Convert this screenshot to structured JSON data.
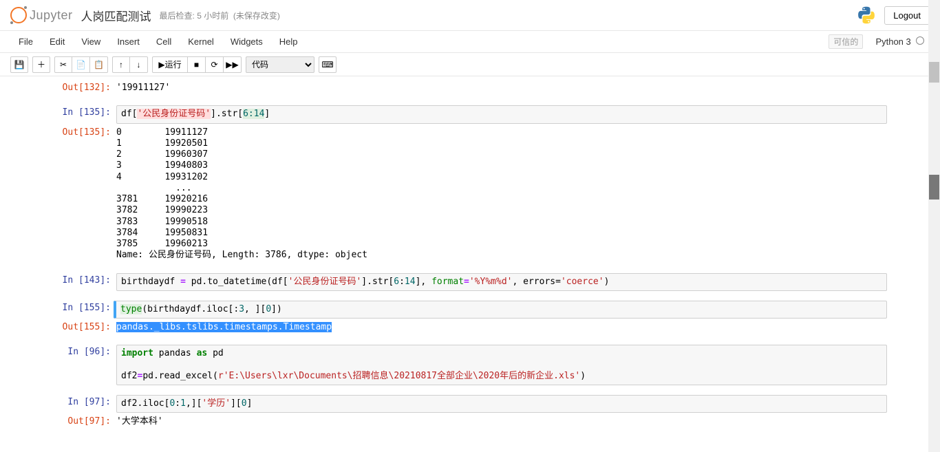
{
  "header": {
    "logo_text": "Jupyter",
    "notebook_name": "人岗匹配测试",
    "last_check": "最后检查: 5 小时前",
    "unsaved": "(未保存改变)",
    "logout": "Logout"
  },
  "menu": {
    "file": "File",
    "edit": "Edit",
    "view": "View",
    "insert": "Insert",
    "cell": "Cell",
    "kernel": "Kernel",
    "widgets": "Widgets",
    "help": "Help",
    "trusted": "可信的",
    "kernel_name": "Python 3"
  },
  "toolbar": {
    "save_icon": "💾",
    "add_icon": "＋",
    "cut_icon": "✂",
    "copy_icon": "📄",
    "paste_icon": "📋",
    "up_icon": "↑",
    "down_icon": "↓",
    "run_prefix": "▶",
    "run_label": " 运行",
    "stop_icon": "■",
    "restart_icon": "⟳",
    "ff_icon": "▶▶",
    "cell_type": "代码",
    "keyboard_icon": "⌨"
  },
  "cells": {
    "c132_out_prompt": "Out[132]:",
    "c132_out": "'19911127'",
    "c135_in_prompt": "In  [135]:",
    "c135_code_prefix": "df[",
    "c135_code_str": "'公民身份证号码'",
    "c135_code_mid": "].str[",
    "c135_code_range": "6:14",
    "c135_code_suffix": "]",
    "c135_out_prompt": "Out[135]:",
    "c135_out": "0        19911127\n1        19920501\n2        19960307\n3        19940803\n4        19931202\n           ...   \n3781     19920216\n3782     19990223\n3783     19990518\n3784     19950831\n3785     19960213\nName: 公民身份证号码, Length: 3786, dtype: object",
    "c143_in_prompt": "In  [143]:",
    "c143_code": {
      "p1": "birthdaydf ",
      "eq": "=",
      "p2": " pd.to_datetime(df[",
      "s1": "'公民身份证号码'",
      "p3": "].str[",
      "n1": "6",
      "colon": ":",
      "n2": "14",
      "p4": "], ",
      "kw1": "format",
      "p5": "=",
      "s2": "'%Y%m%d'",
      "p6": ", errors=",
      "s3": "'coerce'",
      "p7": ")"
    },
    "c155_in_prompt": "In  [155]:",
    "c155_code": {
      "p1": "type",
      "p2": "(birthdaydf.iloc[:",
      "n1": "3",
      "p3": ", ][",
      "n2": "0",
      "p4": "])"
    },
    "c155_out_prompt": "Out[155]:",
    "c155_out": "pandas._libs.tslibs.timestamps.Timestamp",
    "c96_in_prompt": "In   [96]:",
    "c96_code": {
      "p1": "import",
      "p2": " pandas ",
      "p3": "as",
      "p4": " pd\n\ndf2",
      "eq": "=",
      "p5": "pd.read_excel(",
      "s1": "r'E:\\Users\\lxr\\Documents\\招聘信息\\20210817全部企业\\2020年后的新企业.xls'",
      "p6": ")"
    },
    "c97_in_prompt": "In   [97]:",
    "c97_code": {
      "p1": "df2.iloc[",
      "n1": "0",
      "p2": ":",
      "n2": "1",
      "p3": ",][",
      "s1": "'学历'",
      "p4": "][",
      "n3": "0",
      "p5": "]"
    },
    "c97_out_prompt": "Out[97]:",
    "c97_out": "'大学本科'"
  }
}
